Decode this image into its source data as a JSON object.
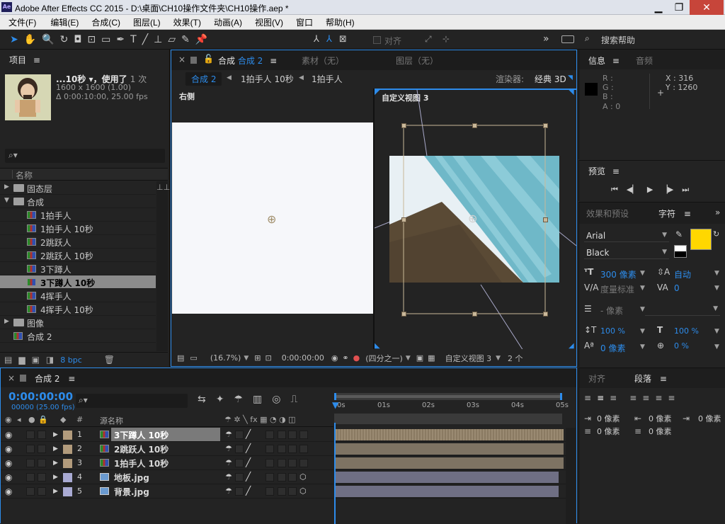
{
  "window": {
    "title": "Adobe After Effects CC 2015 - D:\\桌面\\CH10操作文件夹\\CH10操作.aep *",
    "app_icon": "Ae"
  },
  "menu": [
    "文件(F)",
    "编辑(E)",
    "合成(C)",
    "图层(L)",
    "效果(T)",
    "动画(A)",
    "视图(V)",
    "窗口",
    "帮助(H)"
  ],
  "toolbar": {
    "align_label": "对齐",
    "search_label": "搜索帮助",
    "more": "»"
  },
  "project": {
    "tab": "项目",
    "item_name": "...10秒 ▾，使用了",
    "usage": "1 次",
    "dims": "1600 x 1600 (1.00)",
    "duration": "Δ 0:00:10:00, 25.00 fps",
    "search_placeholder": "",
    "col_name": "名称",
    "tree": [
      {
        "label": "固态层",
        "type": "folder",
        "open": false,
        "indent": 0
      },
      {
        "label": "合成",
        "type": "folder",
        "open": true,
        "indent": 0
      },
      {
        "label": "1拍手人",
        "type": "comp",
        "indent": 1
      },
      {
        "label": "1拍手人 10秒",
        "type": "comp",
        "indent": 1
      },
      {
        "label": "2跳跃人",
        "type": "comp",
        "indent": 1
      },
      {
        "label": "2跳跃人 10秒",
        "type": "comp",
        "indent": 1
      },
      {
        "label": "3下蹲人",
        "type": "comp",
        "indent": 1
      },
      {
        "label": "3下蹲人 10秒",
        "type": "comp",
        "indent": 1,
        "selected": true
      },
      {
        "label": "4挥手人",
        "type": "comp",
        "indent": 1
      },
      {
        "label": "4挥手人 10秒",
        "type": "comp",
        "indent": 1
      },
      {
        "label": "图像",
        "type": "folder",
        "open": false,
        "indent": 0
      },
      {
        "label": "合成 2",
        "type": "comp",
        "indent": 0
      }
    ],
    "bpc": "8 bpc"
  },
  "viewer": {
    "tabs": [
      {
        "prefix": "合成",
        "name": "合成 2"
      },
      {
        "name": "素材（无）"
      },
      {
        "name": "图层（无）"
      }
    ],
    "breadcrumbs": [
      "合成 2",
      "1拍手人 10秒",
      "1拍手人"
    ],
    "renderer_label": "渲染器:",
    "renderer_value": "经典 3D",
    "left_view": "右侧",
    "right_view": "自定义视图 3",
    "zoom": "(16.7%)",
    "timecode": "0:00:00:00",
    "resolution": "(四分之一)",
    "view_select": "自定义视图 3",
    "views_count": "2 个"
  },
  "info": {
    "tabs": [
      "信息",
      "音频"
    ],
    "r": "R :",
    "g": "G :",
    "b": "B :",
    "a": "A : 0",
    "x": "X : 316",
    "y": "Y : 1260"
  },
  "preview": {
    "title": "预览"
  },
  "character": {
    "tabs": [
      "效果和预设",
      "字符"
    ],
    "font": "Arial",
    "style": "Black",
    "size": "300 像素",
    "leading": "自动",
    "kerning": "度量标准",
    "tracking": "0",
    "stroke": "- 像素",
    "vscale": "100 %",
    "hscale": "100 %",
    "baseline": "0 像素",
    "tsume": "0 %",
    "fill_color": "#ffd700"
  },
  "paragraph": {
    "tabs": [
      "对齐",
      "段落"
    ],
    "indent_left": "0 像素",
    "indent_right": "0 像素",
    "indent_first": "0 像素",
    "space_before": "0 像素",
    "space_after": "0 像素"
  },
  "timeline": {
    "tab": "合成 2",
    "timecode": "0:00:00:00",
    "frame_info": "00000 (25.00 fps)",
    "col_num": "#",
    "col_name": "源名称",
    "ruler": [
      "0s",
      "01s",
      "02s",
      "03s",
      "04s",
      "05s"
    ],
    "layers": [
      {
        "num": "1",
        "name": "3下蹲人 10秒",
        "type": "comp",
        "color": "#b29b7c",
        "selected": true,
        "bar": "#7e7363"
      },
      {
        "num": "2",
        "name": "2跳跃人 10秒",
        "type": "comp",
        "color": "#b29b7c",
        "bar": "#7e7363"
      },
      {
        "num": "3",
        "name": "1拍手人 10秒",
        "type": "comp",
        "color": "#b29b7c",
        "bar": "#7e7363"
      },
      {
        "num": "4",
        "name": "地板.jpg",
        "type": "image",
        "color": "#a9aad3",
        "bar": "#6f6f84"
      },
      {
        "num": "5",
        "name": "背景.jpg",
        "type": "image",
        "color": "#a9aad3",
        "bar": "#6f6f84"
      }
    ]
  }
}
